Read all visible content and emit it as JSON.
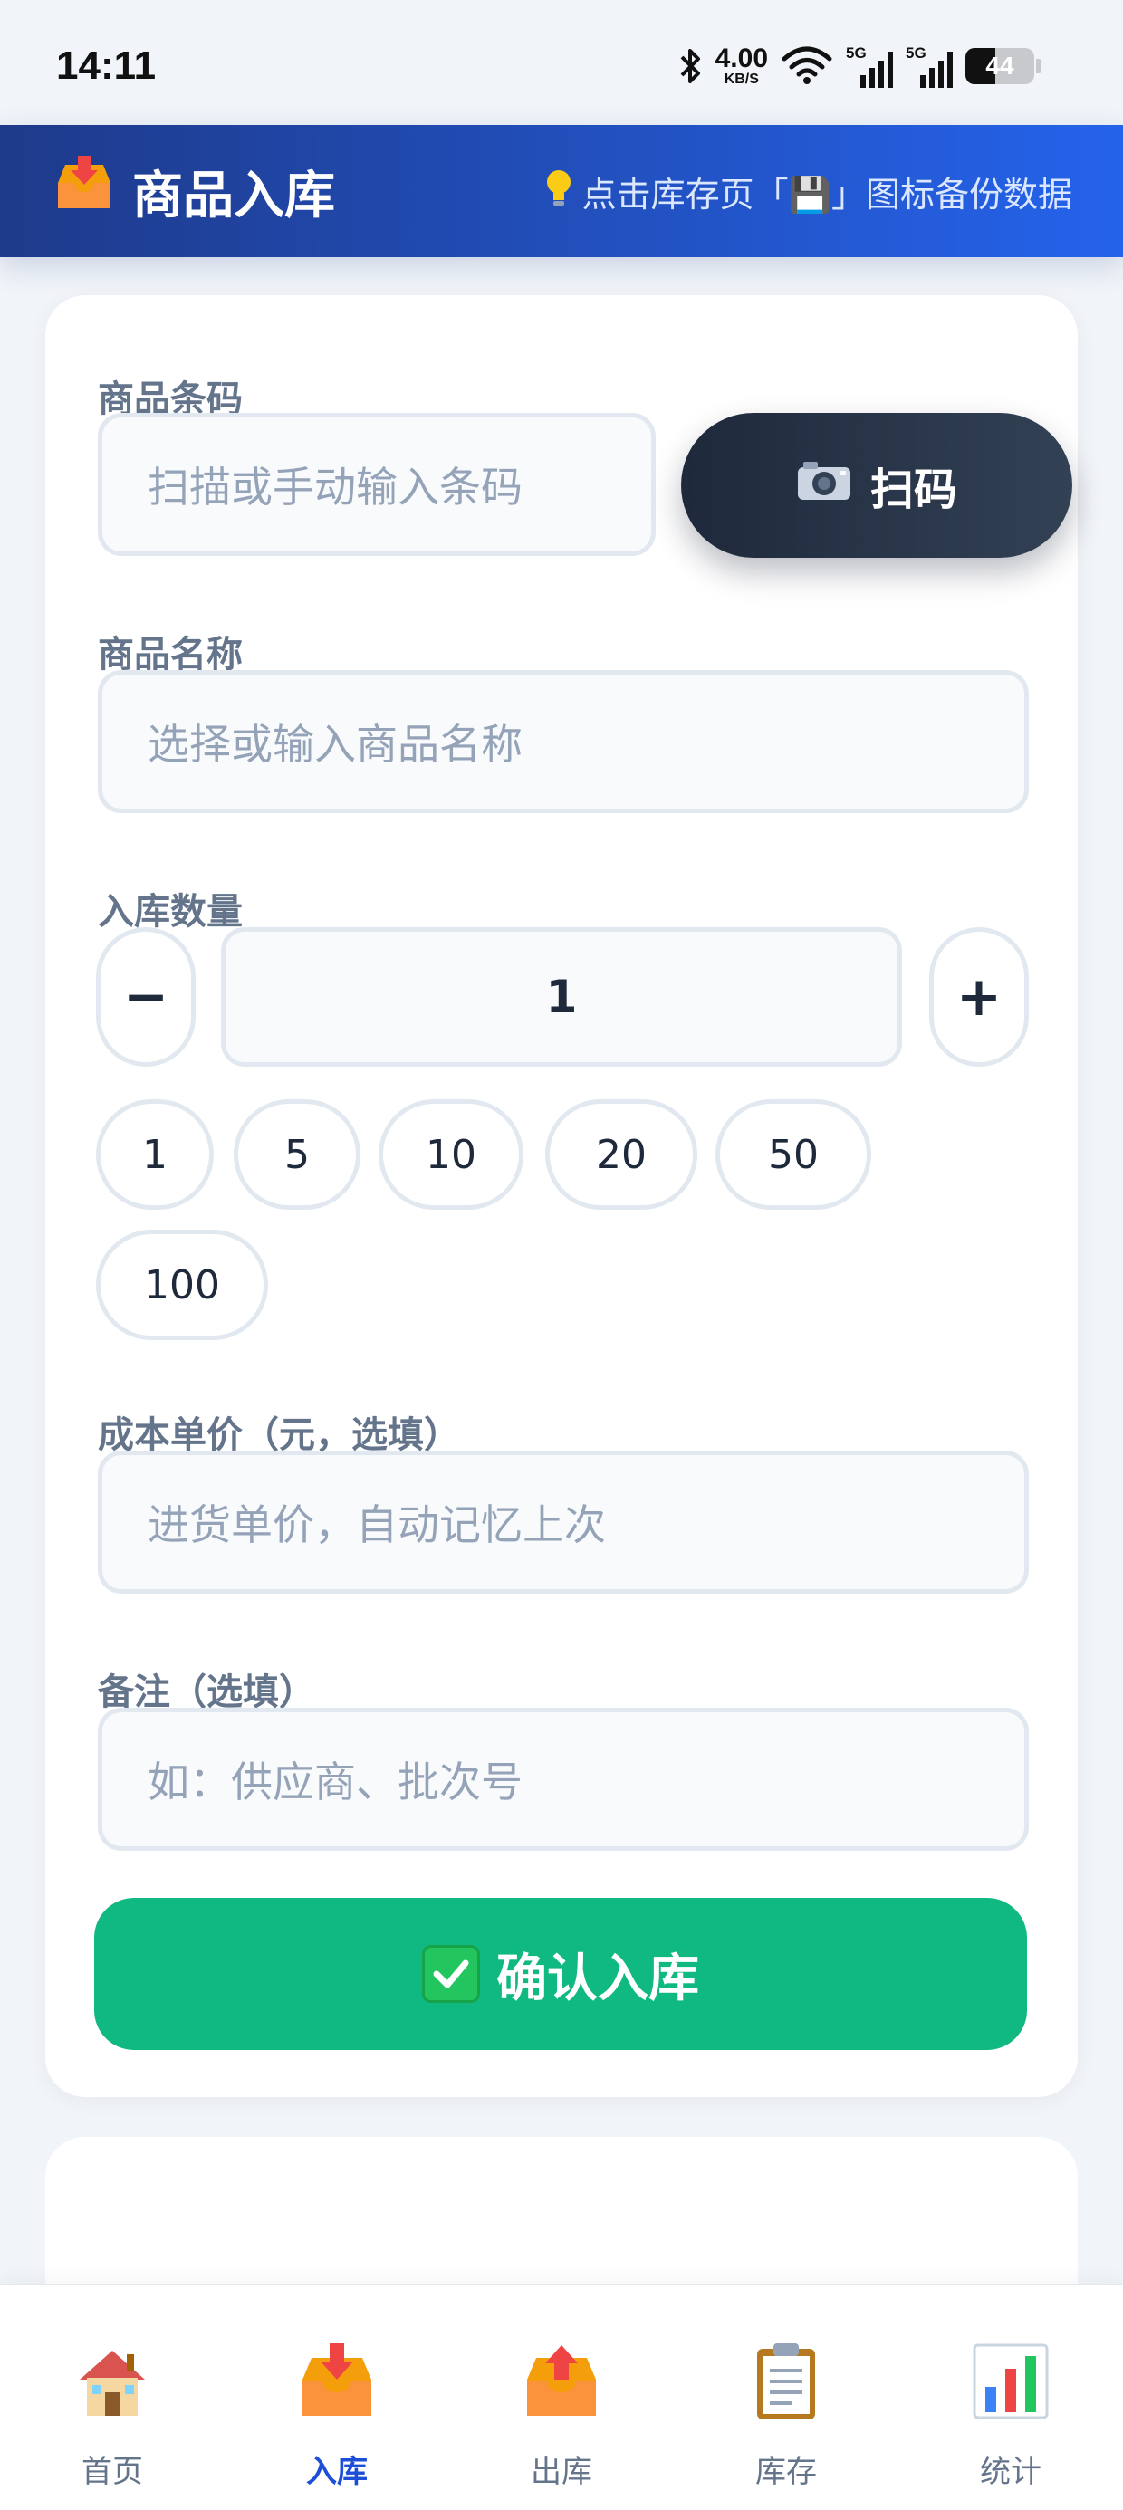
{
  "status_bar": {
    "time": "14:11",
    "net_speed": "4.00",
    "net_unit": "KB/S",
    "signal_1_tag": "5G",
    "signal_2_tag": "5G",
    "battery": "44"
  },
  "header": {
    "title": "商品入库",
    "title_icon": "inbox-tray-icon",
    "hint": "点击库存页「💾」图标备份数据",
    "hint_icon": "lightbulb-icon"
  },
  "form": {
    "barcode_label": "商品条码",
    "barcode_placeholder": "扫描或手动输入条码",
    "scan_button": "扫码",
    "name_label": "商品名称",
    "name_placeholder": "选择或输入商品名称",
    "quantity_label": "入库数量",
    "quantity_value": "1",
    "minus": "−",
    "plus": "+",
    "quick_quantities": [
      "1",
      "5",
      "10",
      "20",
      "50",
      "100"
    ],
    "cost_label": "成本单价（元，选填）",
    "cost_placeholder": "进货单价，自动记忆上次",
    "note_label": "备注（选填）",
    "note_placeholder": "如：供应商、批次号",
    "confirm_button": "确认入库"
  },
  "nav": {
    "items": [
      {
        "label": "首页",
        "icon": "house-icon"
      },
      {
        "label": "入库",
        "icon": "inbox-tray-icon",
        "active": true
      },
      {
        "label": "出库",
        "icon": "outbox-tray-icon"
      },
      {
        "label": "库存",
        "icon": "clipboard-icon"
      },
      {
        "label": "统计",
        "icon": "bar-chart-icon"
      }
    ]
  },
  "colors": {
    "header_start": "#1e3a8a",
    "header_end": "#2563eb",
    "confirm": "#10b981",
    "scan_button": "#1e293b",
    "active_nav": "#1d4ed8"
  }
}
